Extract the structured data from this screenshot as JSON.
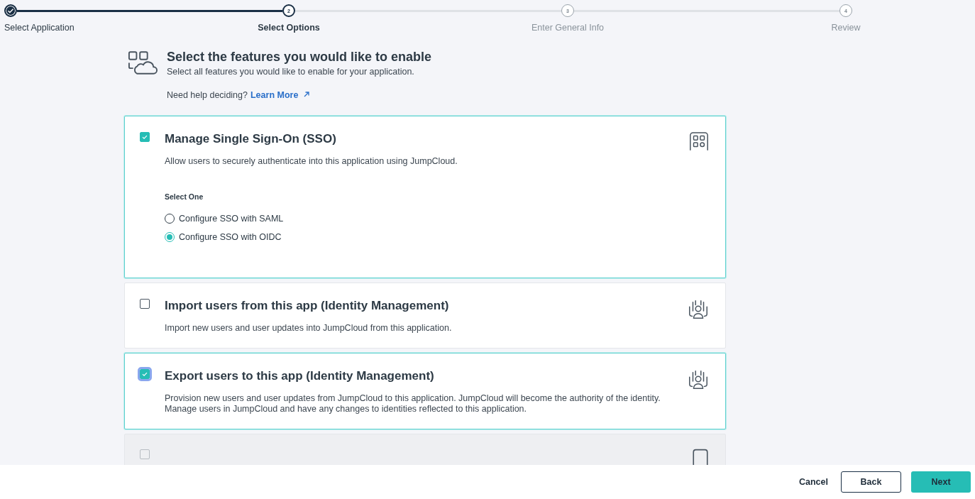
{
  "stepper": {
    "steps": [
      {
        "label": "Select Application",
        "completed": true,
        "selected": false
      },
      {
        "number": "2",
        "label": "Select Options",
        "completed": false,
        "selected": true
      },
      {
        "number": "3",
        "label": "Enter General Info",
        "completed": false,
        "selected": false
      },
      {
        "number": "4",
        "label": "Review",
        "completed": false,
        "selected": false
      }
    ]
  },
  "header": {
    "title": "Select the features you would like to enable",
    "subtitle": "Select all features you would like to enable for your application.",
    "help_text": "Need help deciding?",
    "help_link": "Learn More"
  },
  "features": [
    {
      "title": "Manage Single Sign-On (SSO)",
      "description": "Allow users to securely authenticate into this application using JumpCloud.",
      "checked": true,
      "focused": false,
      "disabled": false,
      "options_label": "Select One",
      "options": [
        {
          "label": "Configure SSO with SAML",
          "selected": false
        },
        {
          "label": "Configure SSO with OIDC",
          "selected": true
        }
      ]
    },
    {
      "title": "Import users from this app (Identity Management)",
      "description": "Import new users and user updates into JumpCloud from this application.",
      "checked": false,
      "focused": false,
      "disabled": false
    },
    {
      "title": "Export users to this app (Identity Management)",
      "description": "Provision new users and user updates from JumpCloud to this application. JumpCloud will become the authority of the identity.\nManage users in JumpCloud and have any changes to identities reflected to this application.",
      "checked": true,
      "focused": true,
      "disabled": false
    },
    {
      "checked": false,
      "focused": false,
      "disabled": true
    }
  ],
  "footer": {
    "cancel": "Cancel",
    "back": "Back",
    "next": "Next"
  }
}
